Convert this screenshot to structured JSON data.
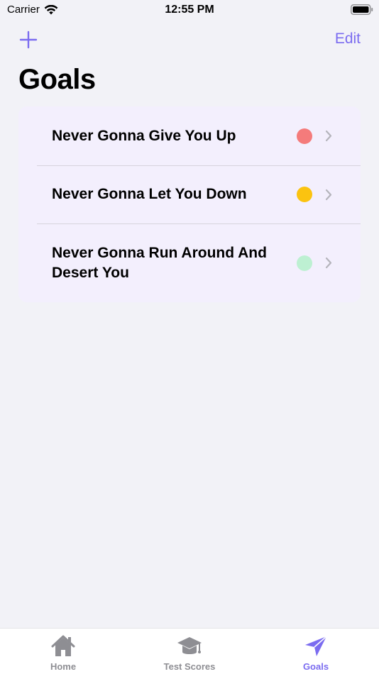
{
  "colors": {
    "accent": "#7b6cf0",
    "card": "#f3effd",
    "inactive": "#8e8e93"
  },
  "status_bar": {
    "carrier": "Carrier",
    "time": "12:55 PM"
  },
  "nav": {
    "add_icon": "plus-icon",
    "edit_label": "Edit",
    "title": "Goals"
  },
  "goals": [
    {
      "title": "Never Gonna Give You Up",
      "color": "#f47b7b"
    },
    {
      "title": "Never Gonna Let You Down",
      "color": "#fbc310"
    },
    {
      "title": "Never Gonna Run Around And Desert You",
      "color": "#bdf0d2"
    }
  ],
  "tab_bar": {
    "tabs": [
      {
        "label": "Home",
        "icon": "house-icon",
        "active": false
      },
      {
        "label": "Test Scores",
        "icon": "graduation-cap-icon",
        "active": false
      },
      {
        "label": "Goals",
        "icon": "paper-plane-icon",
        "active": true
      }
    ]
  }
}
